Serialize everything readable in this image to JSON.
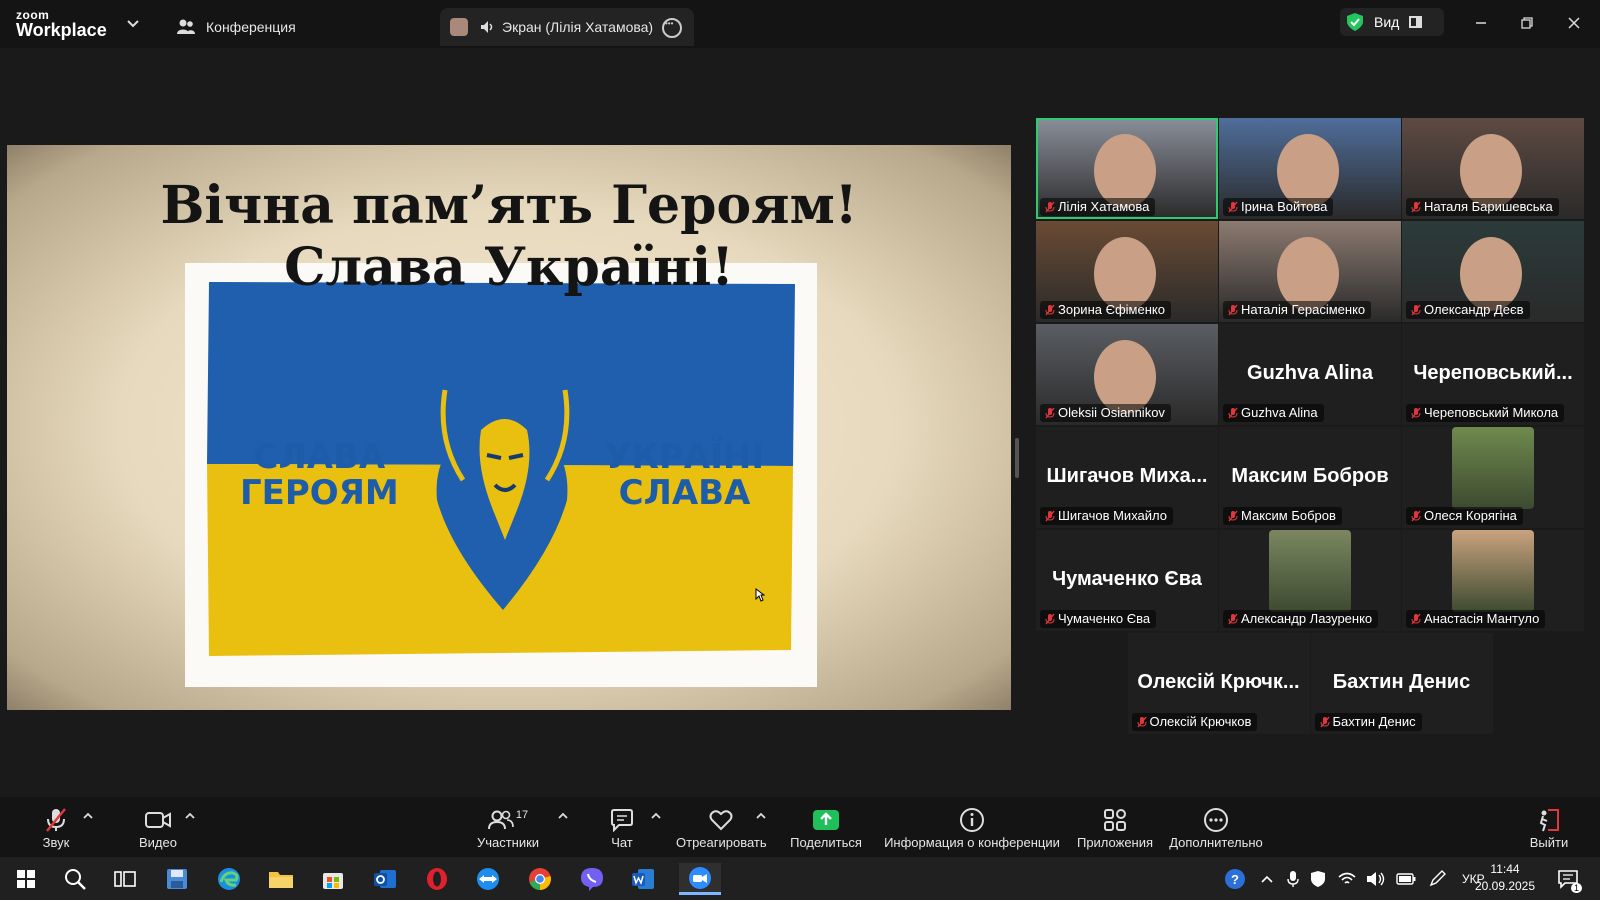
{
  "window": {
    "app_logo_top": "zoom",
    "app_logo_bottom": "Workplace",
    "tab_conference": "Конференция",
    "tab_screen": "Экран (Лілія Хатамова)",
    "view_label": "Вид"
  },
  "shared_screen": {
    "title_line1": "Вічна пам’ять Героям!",
    "title_line2": "Слава Україні!",
    "flag_left_line1": "СЛАВА",
    "flag_left_line2": "ГЕРОЯМ",
    "flag_right_line1": "УКРАЇНІ",
    "flag_right_line2": "СЛАВА",
    "colors": {
      "flag_blue": "#1f5fae",
      "flag_yellow": "#e9bf10",
      "paper": "#eadfc6"
    }
  },
  "participants": [
    {
      "name": "Лілія Хатамова",
      "video": true,
      "active_speaker": true
    },
    {
      "name": "Ірина Войтова",
      "video": true
    },
    {
      "name": "Наталя Баришевська",
      "video": true
    },
    {
      "name": "Зорина Єфіменко",
      "video": true
    },
    {
      "name": "Наталія Герасіменко",
      "video": true
    },
    {
      "name": "Олександр Деєв",
      "video": true
    },
    {
      "name": "Oleksii Osiannikov",
      "video": true
    },
    {
      "name": "Guzhva Alina",
      "display": "Guzhva Alina",
      "video": false
    },
    {
      "name": "Череповський Микола",
      "display": "Череповський...",
      "video": false
    },
    {
      "name": "Шигачов Михайло",
      "display": "Шигачов Миха...",
      "video": false
    },
    {
      "name": "Максим Бобров",
      "display": "Максим Бобров",
      "video": false
    },
    {
      "name": "Олеся Корягіна",
      "video": false,
      "avatar": true
    },
    {
      "name": "Чумаченко Єва",
      "display": "Чумаченко Єва",
      "video": false
    },
    {
      "name": "Александр Лазуренко",
      "video": false,
      "avatar": true
    },
    {
      "name": "Анастасія Мантуло",
      "video": false,
      "avatar": true
    },
    {
      "name": "Олексій Крючков",
      "display": "Олексій Крючк...",
      "video": false
    },
    {
      "name": "Бахтин Денис",
      "display": "Бахтин Денис",
      "video": false
    }
  ],
  "toolbar": {
    "audio": "Звук",
    "video": "Видео",
    "participants": "Участники",
    "participants_count": "17",
    "chat": "Чат",
    "react": "Отреагировать",
    "share": "Поделиться",
    "info": "Информация о конференции",
    "apps": "Приложения",
    "more": "Дополнительно",
    "leave": "Выйти"
  },
  "taskbar": {
    "language": "УКР",
    "time": "11:44",
    "date": "20.09.2025",
    "notification_count": "1"
  }
}
